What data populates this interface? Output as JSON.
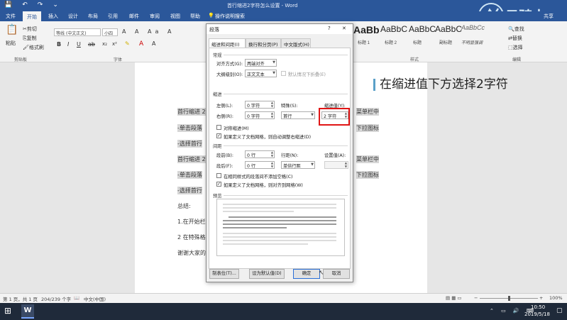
{
  "window": {
    "title": "首行缩进2字符怎么设置 - Word",
    "qat": [
      "💾",
      "↶",
      "↷",
      "⌄"
    ]
  },
  "menu": {
    "tabs": [
      "文件",
      "开始",
      "插入",
      "设计",
      "布局",
      "引用",
      "邮件",
      "审阅",
      "视图",
      "帮助"
    ],
    "search_label": "操作说明搜索",
    "share_label": "共享"
  },
  "ribbon": {
    "clipboard": {
      "paste": "粘贴",
      "cut": "剪切",
      "copy": "复制",
      "format_painter": "格式刷",
      "group": "剪贴板"
    },
    "font": {
      "font_name": "等线 (中文正文)",
      "font_size": "小四",
      "group": "字体"
    },
    "styles": {
      "tiles": [
        {
          "sample": "AaBb",
          "name": "标题 1"
        },
        {
          "sample": "AaBbC",
          "name": "标题 2"
        },
        {
          "sample": "AaBbC",
          "name": "标题"
        },
        {
          "sample": "AaBbC",
          "name": "副标题"
        },
        {
          "sample": "AaBbCc",
          "name": "不明显强调"
        }
      ],
      "group": "样式"
    },
    "editing": {
      "find": "查找",
      "replace": "替换",
      "select": "选择",
      "group": "编辑"
    }
  },
  "watermark_logo": "云骑士",
  "document": {
    "lines": [
      {
        "text": "首行缩进 2",
        "shaded": true
      },
      {
        "text": "-单击段落",
        "shaded": true
      },
      {
        "text": "-选择首行",
        "shaded": true
      },
      {
        "text": "首行缩进 2",
        "shaded": true
      },
      {
        "text": "-单击段落",
        "shaded": true
      },
      {
        "text": "-选择首行",
        "shaded": true
      },
      {
        "text": "总结: ",
        "shaded": false
      },
      {
        "text": "1.在开始栏",
        "shaded": false
      },
      {
        "text": "2 在特殊格",
        "shaded": false
      },
      {
        "text": "谢谢大家的",
        "shaded": false
      }
    ],
    "right_fragments": [
      "菜单栏中",
      "下拉图标",
      "菜单栏中",
      "下拉图标"
    ],
    "caption": "在缩进值下方选择2字符"
  },
  "dialog": {
    "title": "段落",
    "help": "?",
    "close": "✕",
    "tabs": [
      "缩进和间距(I)",
      "换行和分页(P)",
      "中文版式(H)"
    ],
    "general": {
      "section": "常规",
      "alignment_label": "对齐方式(G):",
      "alignment_value": "两端对齐",
      "outline_label": "大纲级别(O):",
      "outline_value": "正文文本",
      "collapsed_label": "默认情况下折叠(E)"
    },
    "indent": {
      "section": "缩进",
      "left_label": "左侧(L):",
      "left_value": "0 字符",
      "right_label": "右侧(R):",
      "right_value": "0 字符",
      "special_label": "特殊(S):",
      "special_value": "首行",
      "by_label": "缩进值(Y):",
      "by_value": "2 字符",
      "mirror_label": "对称缩进(M)",
      "auto_adjust_label": "如果定义了文档网格，则自动调整右缩进(D)"
    },
    "spacing": {
      "section": "间距",
      "before_label": "段前(B):",
      "before_value": "0 行",
      "after_label": "段后(F):",
      "after_value": "0 行",
      "line_label": "行距(N):",
      "line_value": "单倍行距",
      "at_label": "设置值(A):",
      "no_space_label": "在相同样式的段落间不添加空格(C)",
      "snap_grid_label": "如果定义了文档网格，则对齐到网格(W)"
    },
    "preview_label": "预览",
    "buttons": {
      "tabs": "制表位(T)...",
      "default": "设为默认值(D)",
      "ok": "确定",
      "cancel": "取消"
    }
  },
  "status": {
    "pages": "第 1 页，共 1 页",
    "words": "204/239 个字",
    "language": "中文(中国)",
    "zoom": "100%"
  },
  "taskbar": {
    "time": "10:50",
    "date": "2019/5/18",
    "app_badge": "W"
  },
  "colors": {
    "accent": "#2b579a",
    "highlight_box": "#e01515"
  }
}
